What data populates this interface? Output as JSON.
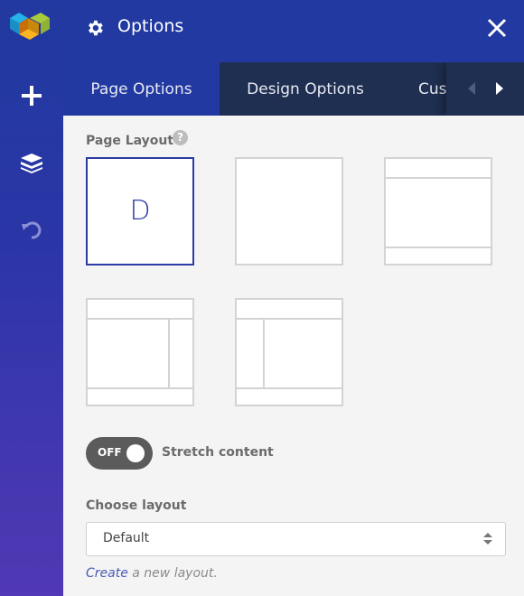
{
  "sidebar": {
    "logo": "cube-logo",
    "items": [
      {
        "icon": "plus-icon",
        "label": "Add element"
      },
      {
        "icon": "layers-icon",
        "label": "Tree view"
      },
      {
        "icon": "undo-icon",
        "label": "Undo"
      }
    ]
  },
  "header": {
    "title": "Options",
    "icon": "gear-icon",
    "close_icon": "close-icon"
  },
  "tabs": [
    {
      "label": "Page Options",
      "active": true
    },
    {
      "label": "Design Options",
      "active": false
    },
    {
      "label": "Custom CSS",
      "active": false
    }
  ],
  "tab_nav": {
    "prev": "chevron-left-icon",
    "next": "chevron-right-icon"
  },
  "page_layout": {
    "label": "Page Layout",
    "help": "?",
    "options": [
      {
        "name": "default",
        "glyph": "D",
        "selected": true
      },
      {
        "name": "full-width",
        "selected": false
      },
      {
        "name": "header-content-footer",
        "selected": false
      },
      {
        "name": "content-right-sidebar",
        "selected": false
      },
      {
        "name": "left-sidebar-content",
        "selected": false
      }
    ]
  },
  "stretch": {
    "toggle_state": "OFF",
    "label": "Stretch content"
  },
  "choose_layout": {
    "label": "Choose layout",
    "value": "Default"
  },
  "create_link": {
    "link": "Create",
    "rest": " a new layout."
  }
}
